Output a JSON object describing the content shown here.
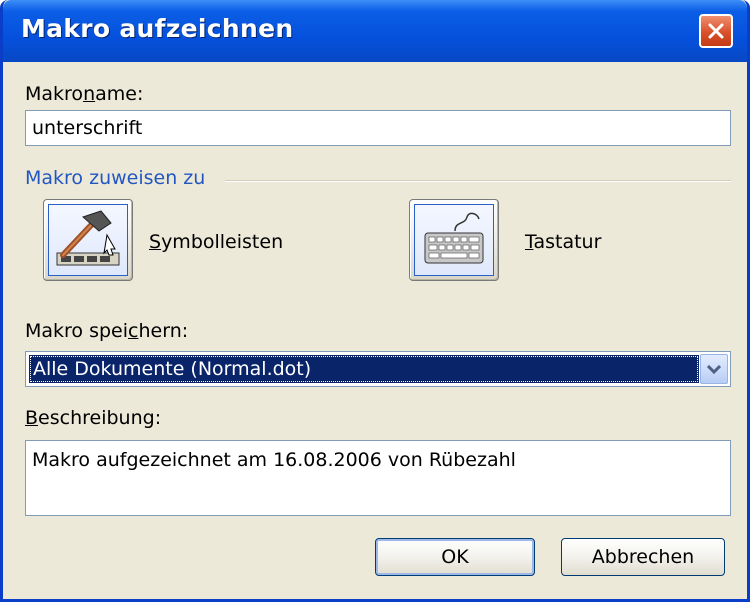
{
  "window": {
    "title": "Makro aufzeichnen"
  },
  "macro_name": {
    "label_pre": "Makro",
    "label_accel": "n",
    "label_post": "ame:",
    "value": "unterschrift"
  },
  "assign": {
    "heading": "Makro zuweisen zu",
    "toolbars": {
      "label_accel": "S",
      "label_rest": "ymbolleisten",
      "icon": "hammer-toolbar-icon"
    },
    "keyboard": {
      "label_accel": "T",
      "label_rest": "astatur",
      "icon": "keyboard-icon"
    }
  },
  "store": {
    "label_pre": "Makro spei",
    "label_accel": "c",
    "label_post": "hern:",
    "selected": "Alle Dokumente (Normal.dot)"
  },
  "description": {
    "label_accel": "B",
    "label_rest": "eschreibung:",
    "value": "Makro aufgezeichnet am 16.08.2006 von Rübezahl"
  },
  "buttons": {
    "ok": "OK",
    "cancel": "Abbrechen"
  },
  "colors": {
    "titlebar": "#0551dd",
    "section_heading": "#2257c3",
    "selection": "#0a246a",
    "dialog_bg": "#ece9d8"
  }
}
